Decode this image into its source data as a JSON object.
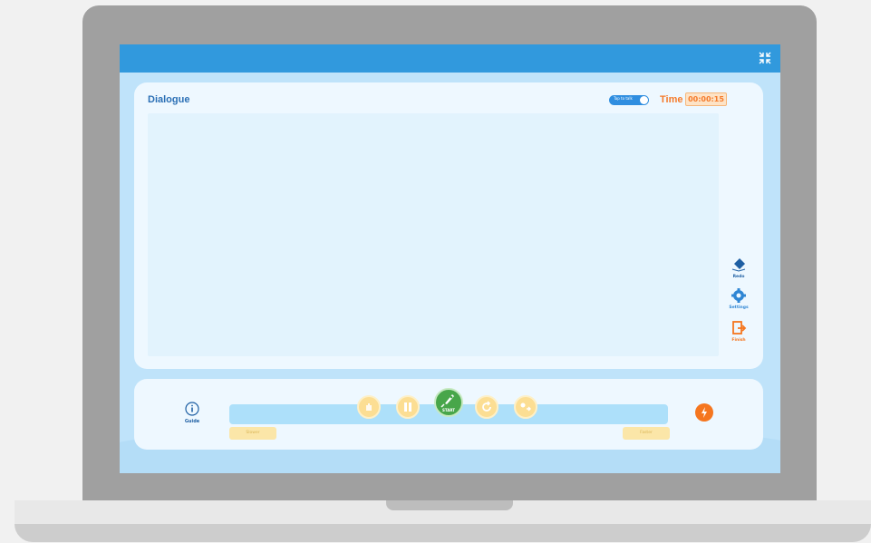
{
  "dialogue": {
    "title": "Dialogue",
    "toggle_label": "Tap to talk",
    "time_label": "Time",
    "time_value": "00:00:15"
  },
  "side_tools": [
    {
      "label": "Redo",
      "icon": "eraser-icon",
      "color": "#1e5fa3"
    },
    {
      "label": "Settings",
      "icon": "gear-icon",
      "color": "#2f86d4"
    },
    {
      "label": "Finish",
      "icon": "exit-icon",
      "color": "#f5761f"
    }
  ],
  "controls": {
    "guide_label": "Guide",
    "start_label": "START",
    "left_pill": "Slower",
    "right_pill": "Faster",
    "buttons": [
      {
        "icon": "hand-icon"
      },
      {
        "icon": "pause-icon"
      },
      {
        "icon": "rocket-icon"
      },
      {
        "icon": "replay-icon"
      },
      {
        "icon": "swap-icon"
      }
    ],
    "bolt_icon": "lightning-icon"
  },
  "colors": {
    "topbar": "#3199dd",
    "accent_orange": "#f57b2b",
    "accent_blue": "#2a6fb5",
    "start_green": "#48a64a"
  }
}
